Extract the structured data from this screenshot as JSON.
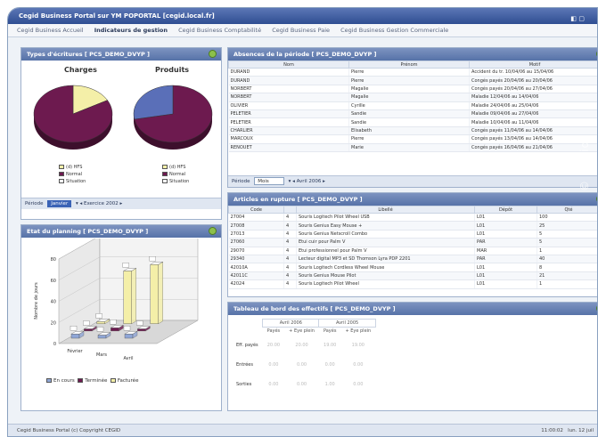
{
  "window": {
    "title": "Cegid Business Portal sur YM POPORTAL [cegid.local.fr]"
  },
  "nav": {
    "items": [
      "Cegid Business Accueil",
      "Indicateurs de gestion",
      "Cegid Business Comptabilité",
      "Cegid Business Paie",
      "Cegid Business Gestion Commerciale"
    ],
    "active_index": 1
  },
  "panel_types": {
    "title": "Types d'écritures [ PCS_DEMO_DVYP ]",
    "charges": {
      "title": "Charges",
      "slices": [
        {
          "label": "(d) HFS",
          "percent": 17,
          "color": "#f4efa8"
        },
        {
          "label": "Normal",
          "percent": 83,
          "color": "#6d1a4f"
        }
      ]
    },
    "produits": {
      "title": "Produits",
      "slices": [
        {
          "label": "(d) HFS",
          "percent": 0,
          "color": "#f4efa8"
        },
        {
          "label": "Normal",
          "percent": 72,
          "color": "#6d1a4f"
        },
        {
          "label": "Situation",
          "percent": 28,
          "color": "#5a6fb8"
        }
      ]
    },
    "legend": [
      "(d) HFS",
      "Normal",
      "Situation"
    ],
    "filter_label": "Période",
    "filter_value": "Janvier",
    "filter_year": "Exercice 2002"
  },
  "panel_absences": {
    "title": "Absences de la période [ PCS_DEMO_DVYP ]",
    "columns": [
      "Nom",
      "Prénom",
      "Motif"
    ],
    "rows": [
      [
        "DURAND",
        "Pierre",
        "Accident du tr. 10/04/06 au 15/04/06"
      ],
      [
        "DURAND",
        "Pierre",
        "Congés payés 20/04/06 au 20/04/06"
      ],
      [
        "NORBERT",
        "Magalie",
        "Congés payés 20/04/06 au 27/04/06"
      ],
      [
        "NORBERT",
        "Magalie",
        "Maladie 12/04/06 au 14/04/06"
      ],
      [
        "OLIVIER",
        "Cyrille",
        "Maladie 24/04/06 au 25/04/06"
      ],
      [
        "PELETIER",
        "Sandie",
        "Maladie 09/04/06 au 27/04/06"
      ],
      [
        "PELETIER",
        "Sandie",
        "Maladie 10/04/06 au 11/04/06"
      ],
      [
        "CHARLIER",
        "Elisabeth",
        "Congés payés 11/04/06 au 14/04/06"
      ],
      [
        "MARCOUX",
        "Pierre",
        "Congés payés 13/04/06 au 14/04/06"
      ],
      [
        "RENOUET",
        "Marie",
        "Congés payés 16/04/06 au 21/04/06"
      ]
    ],
    "filter_label": "Période",
    "filter_value": "Mois",
    "filter_period": "Avril 2006"
  },
  "panel_planning": {
    "title": "Etat du planning [ PCS_DEMO_DVYP ]",
    "ylabel": "Nombre de jours",
    "yticks": [
      "80",
      "60",
      "40",
      "20",
      "0"
    ],
    "categories": [
      "Février",
      "Mars",
      "Avril"
    ],
    "series": [
      {
        "name": "En cours",
        "color": "#8fa6d6"
      },
      {
        "name": "Terminée",
        "color": "#6d1a4f"
      },
      {
        "name": "Facturée",
        "color": "#f4efa8"
      }
    ],
    "bar_values": [
      [
        4,
        3,
        4
      ],
      [
        2,
        3,
        2
      ],
      [
        2,
        50,
        56
      ]
    ],
    "ymax": 80
  },
  "panel_articles": {
    "title": "Articles en rupture [ PCS_DEMO_DVYP ]",
    "columns": [
      "Code",
      "",
      "Libellé",
      "Dépôt",
      "Qté"
    ],
    "rows": [
      [
        "27004",
        "4",
        "Souris Logitech Pilot Wheel USB",
        "L01",
        "100"
      ],
      [
        "27008",
        "4",
        "Souris Genius Easy Mouse +",
        "L01",
        "25"
      ],
      [
        "27013",
        "4",
        "Souris Genius Netscroll Combo",
        "L01",
        "5"
      ],
      [
        "27060",
        "4",
        "Etui cuir pour Palm V",
        "PAR",
        "5"
      ],
      [
        "29070",
        "4",
        "Etui professionnel pour Palm V",
        "MAR",
        "1"
      ],
      [
        "29340",
        "4",
        "Lecteur digital MP3 et SD Thomson Lyra PDP 2201",
        "PAR",
        "40"
      ],
      [
        "42010A",
        "4",
        "Souris Logitech Cordless Wheel Mouse",
        "L01",
        "8"
      ],
      [
        "42011C",
        "4",
        "Souris Genius Mouse Pilot",
        "L01",
        "21"
      ],
      [
        "42024",
        "4",
        "Souris Logitech Pilot Wheel",
        "L01",
        "1"
      ]
    ]
  },
  "panel_dashboard": {
    "title": "Tableau de bord des effectifs [ PCS_DEMO_DVYP ]",
    "col_groups": [
      "Avril 2006",
      "Avril 2005"
    ],
    "subcols": [
      "Payés",
      "+ Eye plein",
      "Payés",
      "+ Eye plein"
    ],
    "rows": [
      {
        "label": "Eff. payés",
        "values": [
          "20.00",
          "20.00",
          "19.00",
          "19.00"
        ]
      },
      {
        "label": "Entrées",
        "values": [
          "0.00",
          "0.00",
          "0.00",
          "0.00"
        ]
      },
      {
        "label": "Sorties",
        "values": [
          "0.00",
          "0.00",
          "1.00",
          "0.00"
        ]
      }
    ]
  },
  "status": {
    "left": "Cegid Business Portal (c) Copyright CEGID",
    "time": "11:00:02",
    "date": "lun. 12 juil"
  },
  "watermark": "© Cegid"
}
